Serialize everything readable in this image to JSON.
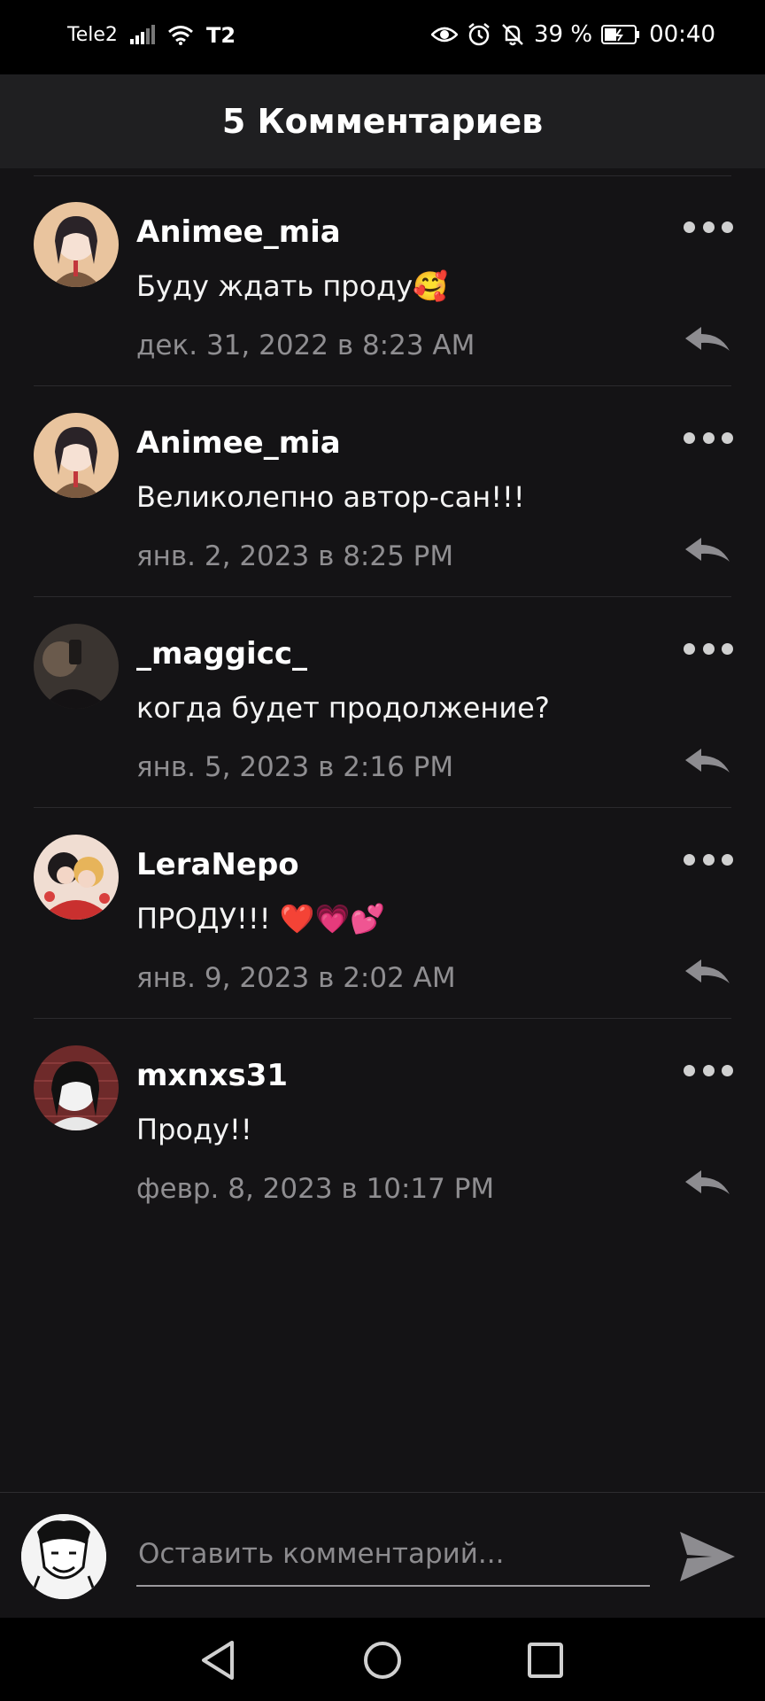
{
  "status_bar": {
    "carrier": "Tele2",
    "battery": "39 %",
    "time": "00:40"
  },
  "header": {
    "title": "5 Комментариев"
  },
  "comments": [
    {
      "username": "Animee_mia",
      "text": "Буду ждать проду🥰",
      "time": "дек. 31, 2022 в 8:23 AM"
    },
    {
      "username": "Animee_mia",
      "text": "Великолепно автор-сан!!!",
      "time": "янв. 2, 2023 в 8:25 PM"
    },
    {
      "username": "_maggicc_",
      "text": "когда будет продолжение?",
      "time": "янв. 5, 2023 в 2:16 PM"
    },
    {
      "username": "LeraNepo",
      "text": "ПРОДУ!!! ❤️💗💕",
      "time": "янв. 9, 2023 в 2:02 AM"
    },
    {
      "username": "mxnxs31",
      "text": "Проду!!",
      "time": "февр. 8, 2023 в 10:17 PM"
    }
  ],
  "composer": {
    "placeholder": "Оставить комментарий..."
  },
  "colors": {
    "background": "#141315",
    "header": "#1f1f21",
    "muted_text": "#8f8e91"
  },
  "icons": [
    "eye-icon",
    "alarm-icon",
    "bell-off-icon",
    "battery-icon",
    "more-icon",
    "reply-icon",
    "send-icon",
    "back-icon",
    "home-icon",
    "recents-icon"
  ]
}
